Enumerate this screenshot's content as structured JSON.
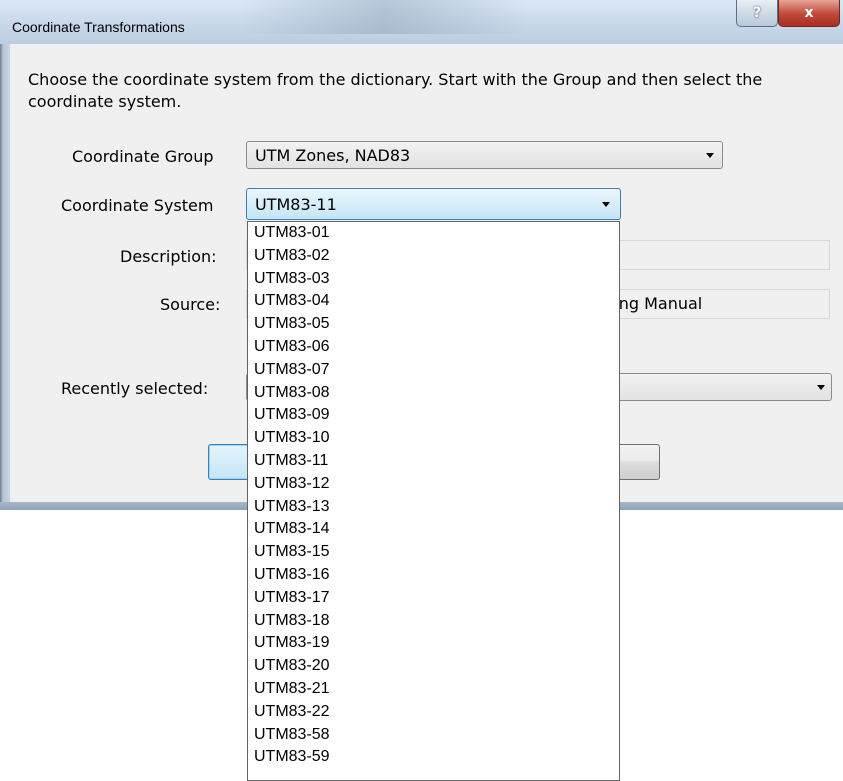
{
  "window": {
    "title": "Coordinate Transformations",
    "help_glyph": "?",
    "close_glyph": "x"
  },
  "instructions": "Choose the coordinate system from the dictionary.  Start with the Group and then select the coordinate system.",
  "group": {
    "label": "Coordinate Group",
    "value": "UTM Zones, NAD83"
  },
  "system": {
    "label": "Coordinate System",
    "value": "UTM83-11"
  },
  "description": {
    "label": "Description:",
    "value": ""
  },
  "source": {
    "label": "Source:",
    "value_visible": "king Manual"
  },
  "recent": {
    "label": "Recently selected:",
    "value": ""
  },
  "dropdown": {
    "items": [
      "UTM83-01",
      "UTM83-02",
      "UTM83-03",
      "UTM83-04",
      "UTM83-05",
      "UTM83-06",
      "UTM83-07",
      "UTM83-08",
      "UTM83-09",
      "UTM83-10",
      "UTM83-11",
      "UTM83-12",
      "UTM83-13",
      "UTM83-14",
      "UTM83-15",
      "UTM83-16",
      "UTM83-17",
      "UTM83-18",
      "UTM83-19",
      "UTM83-20",
      "UTM83-21",
      "UTM83-22",
      "UTM83-58",
      "UTM83-59"
    ]
  },
  "icons": {
    "combo_arrow": "chevron-down-icon",
    "help": "help-icon",
    "close": "close-icon"
  }
}
